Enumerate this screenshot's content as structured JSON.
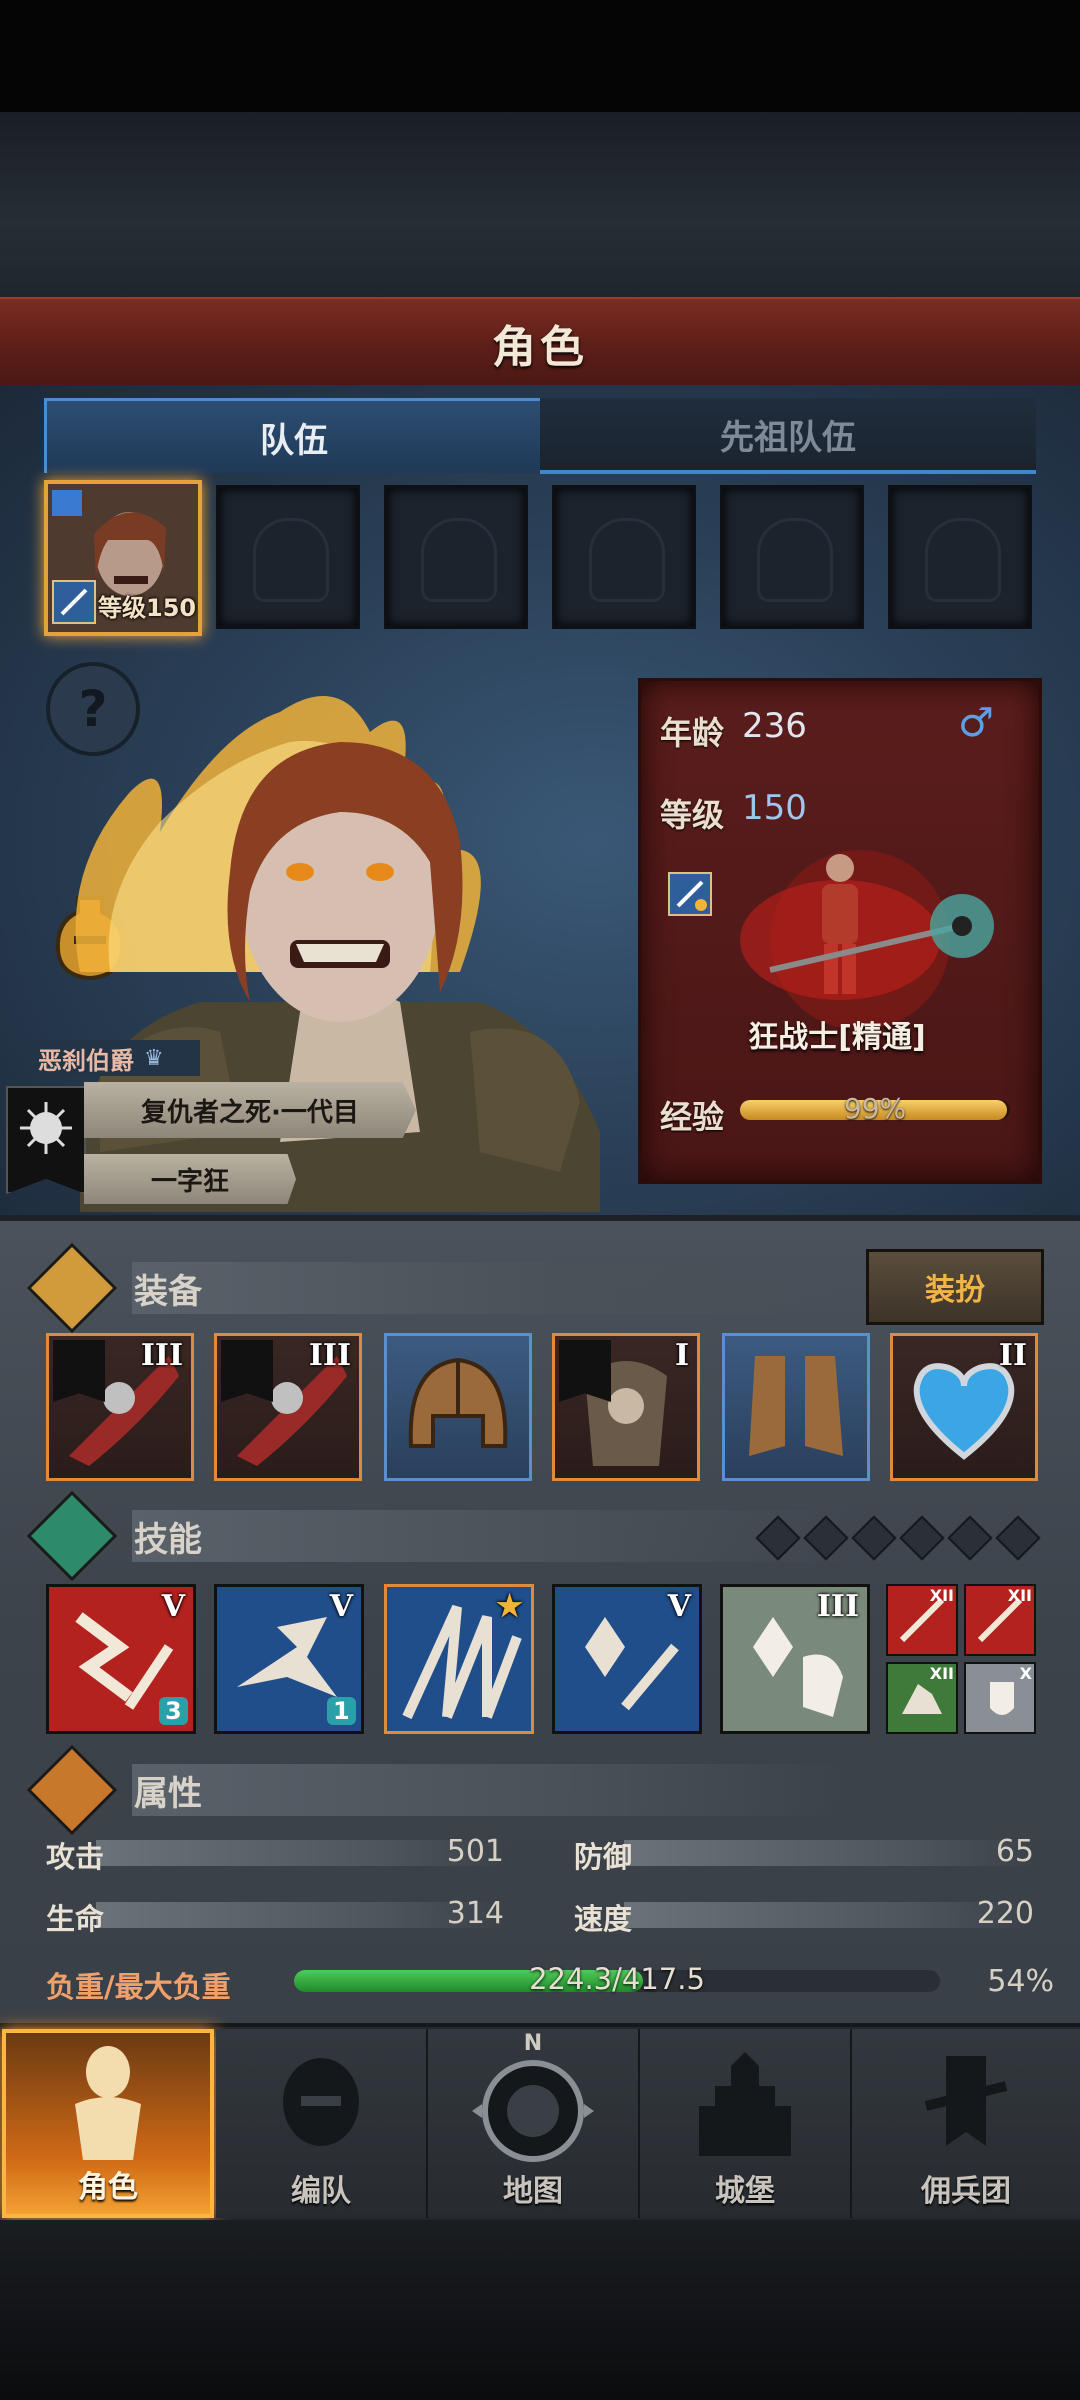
{
  "title": "角色",
  "tabs": [
    {
      "label": "队伍",
      "active": true
    },
    {
      "label": "先祖队伍",
      "active": false
    }
  ],
  "team": {
    "slot1_level_label": "等级150",
    "empty_slots": 5
  },
  "character": {
    "age_label": "年龄",
    "age_value": "236",
    "gender_icon": "male-icon",
    "level_label": "等级",
    "level_value": "150",
    "class_name": "狂战士[精通]",
    "exp_label": "经验",
    "exp_percent_text": "99%",
    "exp_fraction": 0.99,
    "rank_tag": "恶刹伯爵",
    "title_primary": "复仇者之死·一代目",
    "title_secondary": "一字狂"
  },
  "equipment": {
    "header": "装备",
    "dress_button": "装扮",
    "items": [
      {
        "name": "weapon-left",
        "tier": "III",
        "frame": "orange"
      },
      {
        "name": "weapon-right",
        "tier": "III",
        "frame": "orange"
      },
      {
        "name": "helmet",
        "tier": "",
        "frame": "blue"
      },
      {
        "name": "armor",
        "tier": "I",
        "frame": "orange"
      },
      {
        "name": "boots",
        "tier": "",
        "frame": "blue"
      },
      {
        "name": "amulet",
        "tier": "II",
        "frame": "orange"
      }
    ]
  },
  "skills": {
    "header": "技能",
    "pips": 6,
    "items": [
      {
        "tier": "V",
        "badge": "3",
        "color": "#b3221e"
      },
      {
        "tier": "V",
        "badge": "1",
        "color": "#1f4e8a"
      },
      {
        "tier": "★",
        "badge": "",
        "color": "#1f4e8a"
      },
      {
        "tier": "V",
        "badge": "",
        "color": "#1f4e8a"
      },
      {
        "tier": "III",
        "badge": "",
        "color": "#7a8a7a"
      }
    ],
    "mini": [
      {
        "tier": "XII",
        "color": "#b3221e"
      },
      {
        "tier": "XII",
        "color": "#b3221e"
      },
      {
        "tier": "XII",
        "color": "#3f7a3a"
      },
      {
        "tier": "X",
        "color": "#8a8f95"
      }
    ]
  },
  "attributes": {
    "header": "属性",
    "attack_label": "攻击",
    "attack_value": "501",
    "defense_label": "防御",
    "defense_value": "65",
    "hp_label": "生命",
    "hp_value": "314",
    "speed_label": "速度",
    "speed_value": "220",
    "load_label": "负重/最大负重",
    "load_value": "224.3/417.5",
    "load_percent": "54%",
    "load_fraction": 0.54
  },
  "nav": [
    {
      "label": "角色",
      "active": true
    },
    {
      "label": "编队",
      "active": false
    },
    {
      "label": "地图",
      "active": false
    },
    {
      "label": "城堡",
      "active": false
    },
    {
      "label": "佣兵团",
      "active": false
    }
  ],
  "compass_letter": "N"
}
